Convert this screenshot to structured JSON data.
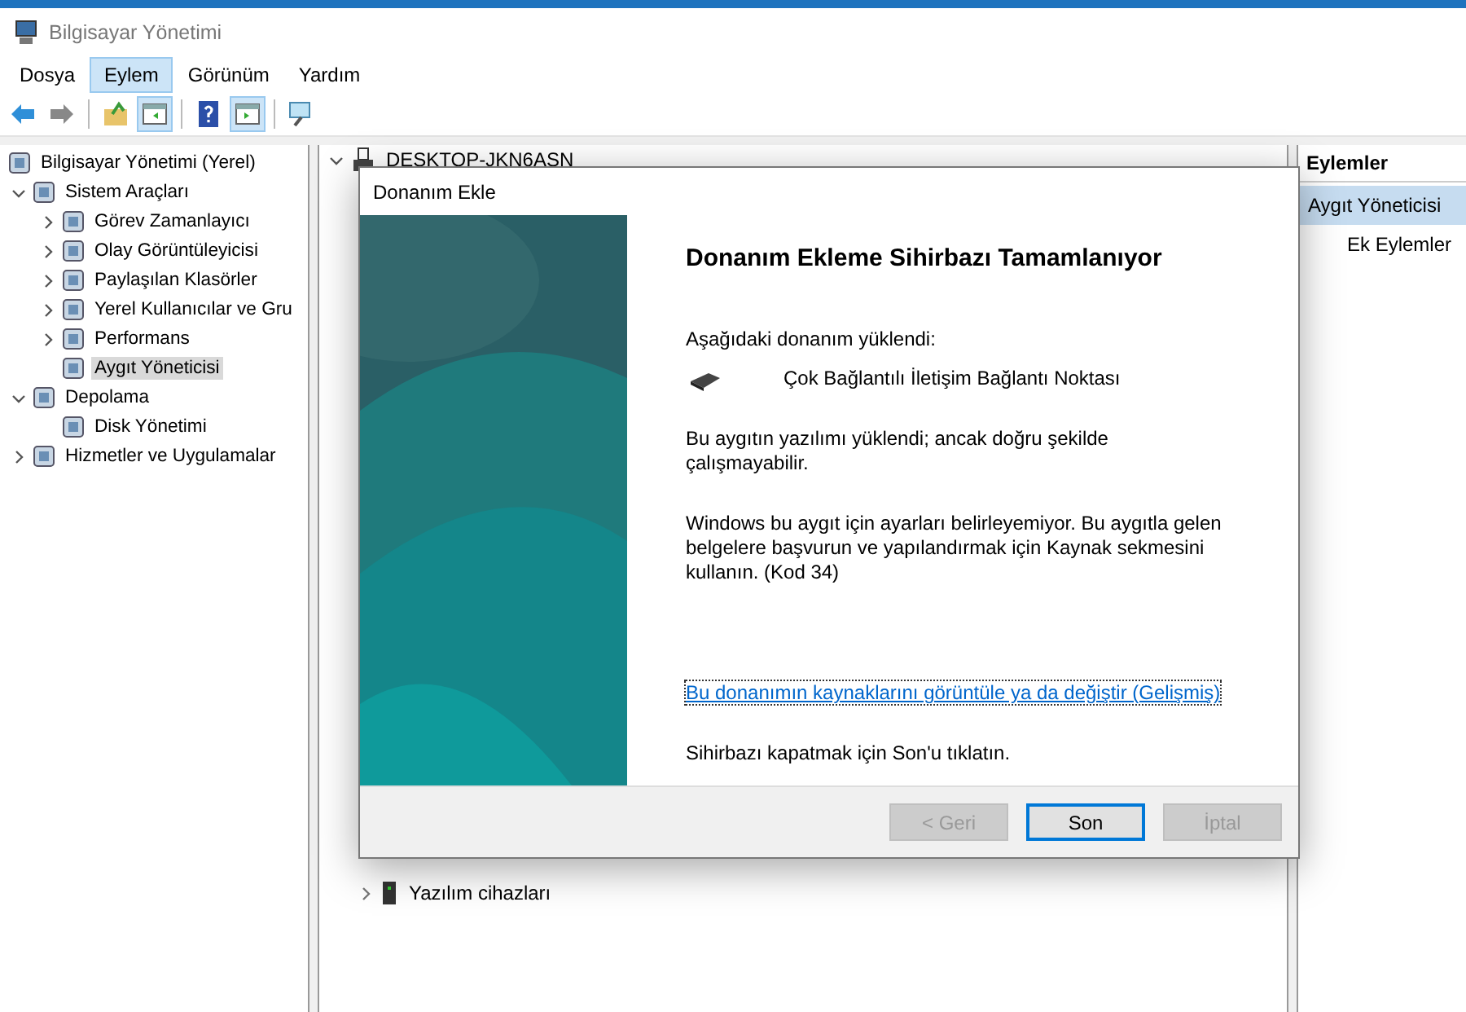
{
  "window": {
    "title": "Bilgisayar Yönetimi"
  },
  "menu": [
    {
      "label": "Dosya",
      "selected": false
    },
    {
      "label": "Eylem",
      "selected": true
    },
    {
      "label": "Görünüm",
      "selected": false
    },
    {
      "label": "Yardım",
      "selected": false
    }
  ],
  "toolbar": [
    {
      "pressed": false
    },
    {
      "pressed": false
    },
    {
      "pressed": false
    },
    {
      "pressed": true
    },
    {
      "pressed": false
    },
    {
      "pressed": true
    },
    {
      "pressed": false
    }
  ],
  "tree": [
    {
      "label": "Bilgisayar Yönetimi (Yerel)",
      "selected": false,
      "children": [
        {
          "label": "Sistem Araçları",
          "selected": false,
          "expanded": true,
          "children": [
            {
              "label": "Görev Zamanlayıcı",
              "selected": false,
              "expanded": false
            },
            {
              "label": "Olay Görüntüleyicisi",
              "selected": false,
              "expanded": false
            },
            {
              "label": "Paylaşılan Klasörler",
              "selected": false,
              "expanded": false
            },
            {
              "label": "Yerel Kullanıcılar ve Gru",
              "selected": false,
              "expanded": false
            },
            {
              "label": "Performans",
              "selected": false,
              "expanded": false
            },
            {
              "label": "Aygıt Yöneticisi",
              "selected": true
            }
          ]
        },
        {
          "label": "Depolama",
          "selected": false,
          "expanded": true,
          "children": [
            {
              "label": "Disk Yönetimi",
              "selected": false
            }
          ]
        },
        {
          "label": "Hizmetler ve Uygulamalar",
          "selected": false,
          "expanded": false
        }
      ]
    }
  ],
  "devices": {
    "root": {
      "label": "DESKTOP-JKN6ASN",
      "expanded": true
    },
    "visible_item": {
      "label": "Yazılım cihazları",
      "expanded": false
    }
  },
  "actions": {
    "header": "Eylemler",
    "section": "Aygıt Yöneticisi",
    "items": [
      "Ek Eylemler"
    ]
  },
  "dialog": {
    "title": "Donanım Ekle",
    "heading": "Donanım Ekleme Sihirbazı Tamamlanıyor",
    "installed_label": "Aşağıdaki donanım yüklendi:",
    "device": "Çok Bağlantılı İletişim Bağlantı Noktası",
    "paragraphs": [
      "Bu aygıtın yazılımı yüklendi; ancak doğru şekilde çalışmayabilir.",
      "Windows bu aygıt için ayarları belirleyemiyor. Bu aygıtla gelen belgelere başvurun ve yapılandırmak için Kaynak sekmesini kullanın. (Kod 34)"
    ],
    "link": "Bu donanımın kaynaklarını görüntüle ya da değiştir (Gelişmiş)",
    "closing": "Sihirbazı kapatmak için Son'u tıklatın.",
    "buttons": [
      {
        "label": "< Geri",
        "disabled": true,
        "default": false
      },
      {
        "label": "Son",
        "disabled": false,
        "default": true
      },
      {
        "label": "İptal",
        "disabled": true,
        "default": false
      }
    ]
  }
}
